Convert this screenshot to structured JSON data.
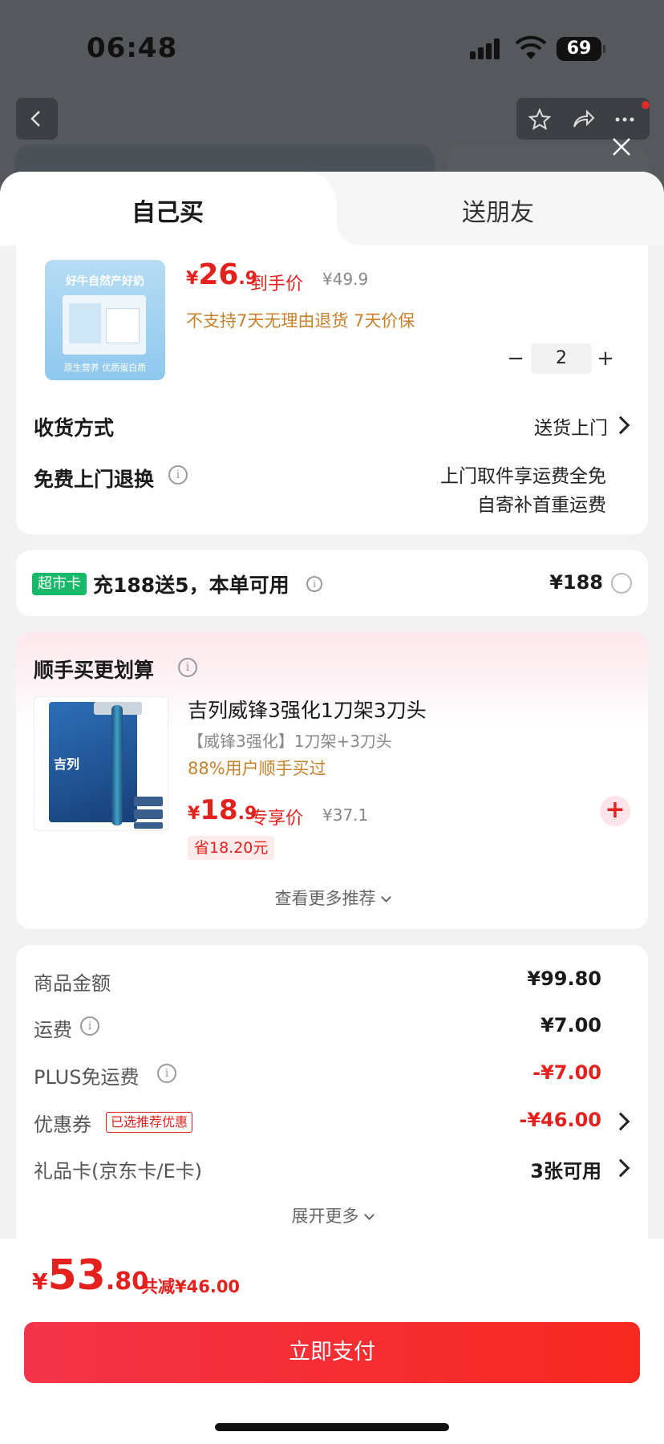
{
  "status": {
    "time": "06:48",
    "battery": "69"
  },
  "tabs": {
    "self": "自己买",
    "friend": "送朋友"
  },
  "product": {
    "image_slogan": "好牛自然产好奶",
    "image_footer": "原生营养 优质蛋白质",
    "yen": "¥",
    "price_int": "26",
    "price_dec": ".9",
    "price_tag": "到手价",
    "old_price": "¥49.9",
    "policy": "不支持7天无理由退货  7天价保",
    "quantity": "2",
    "minus": "−",
    "plus": "+"
  },
  "delivery": {
    "label": "收货方式",
    "value": "送货上门"
  },
  "return": {
    "label": "免费上门退换",
    "line1": "上门取件享运费全免",
    "line2": "自寄补首重运费"
  },
  "supermarket": {
    "badge": "超市卡",
    "text": "充188送5，本单可用",
    "amount": "¥188"
  },
  "bundle": {
    "title": "顺手买更划算",
    "item_title": "吉列威锋3强化1刀架3刀头",
    "item_sub": "【威锋3强化】1刀架+3刀头",
    "item_pct": "88%用户顺手买过",
    "logo_text": "吉列",
    "yen": "¥",
    "price_int": "18",
    "price_dec": ".9",
    "price_tag": "专享价",
    "old_price": "¥37.1",
    "save": "省18.20元",
    "add": "+",
    "more": "查看更多推荐"
  },
  "summary": {
    "goods_label": "商品金额",
    "goods_value": "¥99.80",
    "freight_label": "运费",
    "freight_value": "¥7.00",
    "plus_label": "PLUS免运费",
    "plus_value": "-¥7.00",
    "coupon_label": "优惠券",
    "coupon_badge": "已选推荐优惠",
    "coupon_value": "-¥46.00",
    "gift_label": "礼品卡(京东卡/E卡)",
    "gift_value": "3张可用",
    "expand": "展开更多"
  },
  "footer": {
    "yen": "¥",
    "total_int": "53",
    "total_dec": ".80",
    "saved": "共减¥46.00",
    "pay": "立即支付"
  }
}
